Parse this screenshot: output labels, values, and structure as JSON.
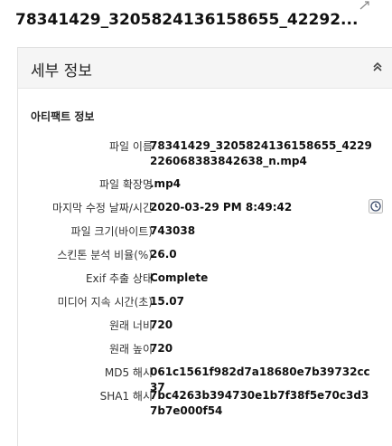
{
  "header": {
    "title": "78341429_3205824136158655_42292..."
  },
  "panel": {
    "title": "세부 정보",
    "section_title": "아티팩트 정보",
    "rows": [
      {
        "label": "파일 이름",
        "value": "78341429_3205824136158655_4229226068383842638_n.mp4"
      },
      {
        "label": "파일 확장명",
        "value": ".mp4"
      },
      {
        "label": "마지막 수정 날짜/시간",
        "value": "2020-03-29 PM 8:49:42"
      },
      {
        "label": "파일 크기(바이트)",
        "value": "743038"
      },
      {
        "label": "스킨톤 분석 비율(%)",
        "value": "26.0"
      },
      {
        "label": "Exif 추출 상태",
        "value": "Complete"
      },
      {
        "label": "미디어 지속 시간(초)",
        "value": "15.07"
      },
      {
        "label": "원래 너비",
        "value": "720"
      },
      {
        "label": "원래 높이",
        "value": "720"
      },
      {
        "label": "MD5 해시",
        "value": "061c1561f982d7a18680e7b39732cc37"
      },
      {
        "label": "SHA1 해시",
        "value": "7bc4263b394730e1b7f38f5e70c3d37b7e000f54"
      }
    ]
  },
  "icons": {
    "corner": "cursor-resize-icon",
    "collapse": "chevron-double-up-icon",
    "time": "clock-icon"
  },
  "colors": {
    "header_bg": "#f5f5f5",
    "border": "#e1e1e1"
  }
}
